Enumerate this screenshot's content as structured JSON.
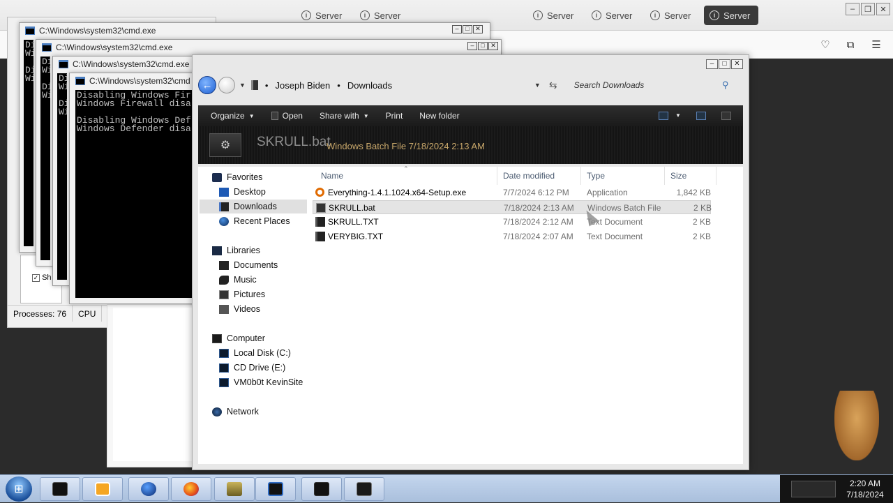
{
  "browser": {
    "tabs": [
      {
        "label": "Server",
        "active": false
      },
      {
        "label": "Server",
        "active": false
      },
      {
        "label": "Server",
        "active": false
      },
      {
        "label": "Server",
        "active": false
      },
      {
        "label": "Server",
        "active": false
      },
      {
        "label": "Server",
        "active": true
      }
    ]
  },
  "task_manager": {
    "processes": "Processes: 76",
    "cpu": "CPU",
    "checkbox_label": "Sh",
    "checkbox_glyph": "✓"
  },
  "cmd_windows": [
    {
      "title": "C:\\Windows\\system32\\cmd.exe",
      "lines": "Di\nWi\n\nDi\nWi"
    },
    {
      "title": "C:\\Windows\\system32\\cmd.exe",
      "lines": "Di\nWi\n\nDi\nWi"
    },
    {
      "title": "C:\\Windows\\system32\\cmd.exe",
      "lines": "Di\nWi\n\nDi\nWi"
    },
    {
      "title": "C:\\Windows\\system32\\cmd",
      "lines": "Disabling Windows Fir\nWindows Firewall disa\n\nDisabling Windows Def\nWindows Defender disa"
    }
  ],
  "explorer": {
    "breadcrumb": [
      "Joseph Biden",
      "Downloads"
    ],
    "search_placeholder": "Search Downloads",
    "commands": [
      {
        "label": "Organize",
        "has_caret": true
      },
      {
        "label": "Open",
        "has_caret": false
      },
      {
        "label": "Share with",
        "has_caret": true
      },
      {
        "label": "Print",
        "has_caret": false
      },
      {
        "label": "New folder",
        "has_caret": false
      }
    ],
    "details": {
      "name": "SKRULL.bat",
      "meta": "Windows Batch File   7/18/2024 2:13 AM"
    },
    "nav": {
      "favorites": {
        "label": "Favorites",
        "items": [
          "Desktop",
          "Downloads",
          "Recent Places"
        ]
      },
      "libraries": {
        "label": "Libraries",
        "items": [
          "Documents",
          "Music",
          "Pictures",
          "Videos"
        ]
      },
      "computer": {
        "label": "Computer",
        "items": [
          "Local Disk (C:)",
          "CD Drive (E:)",
          "VM0b0t KevinSite"
        ]
      },
      "network": {
        "label": "Network"
      }
    },
    "columns": [
      "Name",
      "Date modified",
      "Type",
      "Size"
    ],
    "files": [
      {
        "name": "Everything-1.4.1.1024.x64-Setup.exe",
        "date": "7/7/2024 6:12 PM",
        "type": "Application",
        "size": "1,842 KB",
        "icon": "exe"
      },
      {
        "name": "SKRULL.bat",
        "date": "7/18/2024 2:13 AM",
        "type": "Windows Batch File",
        "size": "2 KB",
        "icon": "bat"
      },
      {
        "name": "SKRULL.TXT",
        "date": "7/18/2024 2:12 AM",
        "type": "Text Document",
        "size": "2 KB",
        "icon": "txt"
      },
      {
        "name": "VERYBIG.TXT",
        "date": "7/18/2024 2:07 AM",
        "type": "Text Document",
        "size": "2 KB",
        "icon": "txt"
      }
    ]
  },
  "taskbar": {
    "clock_time": "2:20 AM",
    "clock_date": "7/18/2024"
  }
}
